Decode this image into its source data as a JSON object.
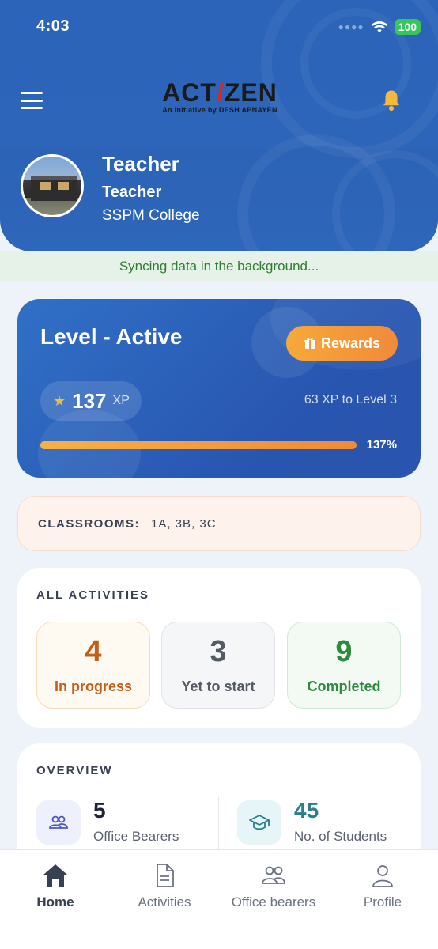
{
  "status_bar": {
    "time": "4:03",
    "battery": "100"
  },
  "header": {
    "logo_main": "ACT",
    "logo_slash": "/",
    "logo_end": "ZEN",
    "logo_tagline": "An initiative by DESH APNAYEN",
    "user_name": "Teacher",
    "user_role": "Teacher",
    "user_college": "SSPM College"
  },
  "sync_message": "Syncing data in the background...",
  "level_card": {
    "title": "Level - Active",
    "rewards_label": "Rewards",
    "xp_value": "137",
    "xp_unit": "XP",
    "xp_to_next": "63 XP to Level 3",
    "progress_label": "137%",
    "progress_fraction": 1.0
  },
  "classrooms": {
    "label": "CLASSROOMS:",
    "value": "1A, 3B, 3C"
  },
  "activities": {
    "title": "ALL ACTIVITIES",
    "items": [
      {
        "count": "4",
        "label": "In progress"
      },
      {
        "count": "3",
        "label": "Yet to start"
      },
      {
        "count": "9",
        "label": "Completed"
      }
    ]
  },
  "overview": {
    "title": "OVERVIEW",
    "items": [
      {
        "value": "5",
        "label": "Office Bearers",
        "icon": "people-icon"
      },
      {
        "value": "45",
        "label": "No. of Students",
        "icon": "graduation-cap-icon"
      }
    ]
  },
  "bottom_nav": {
    "items": [
      {
        "label": "Home",
        "icon": "home-icon",
        "active": true
      },
      {
        "label": "Activities",
        "icon": "document-icon"
      },
      {
        "label": "Office bearers",
        "icon": "people-icon"
      },
      {
        "label": "Profile",
        "icon": "person-icon"
      }
    ]
  },
  "colors": {
    "header_blue": "#2d65ba",
    "accent_orange": "#f08a3a",
    "in_progress": "#c45f1a",
    "completed": "#2e8b3e",
    "sync_green": "#2e7d32"
  }
}
